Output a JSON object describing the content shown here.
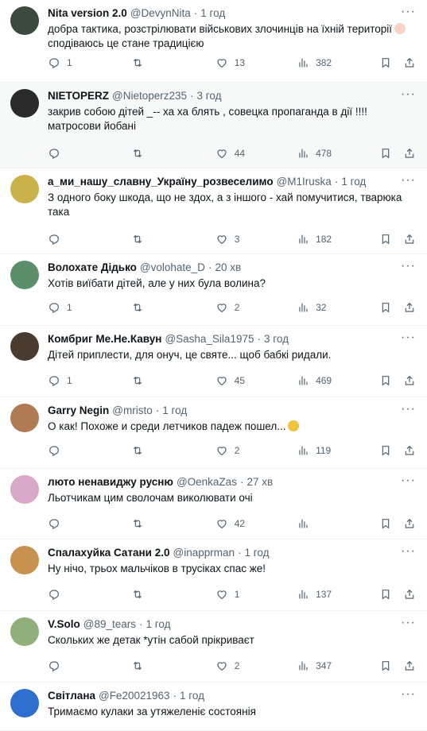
{
  "tweets": [
    {
      "name": "Nita version 2.0",
      "handle": "@DevynNita",
      "time": "1 год",
      "lines": [
        "добра тактика, розстрілювати військових злочинців на їхній території",
        "сподіваюсь це стане традицією"
      ],
      "emoji": "thumbs-up",
      "replies": "1",
      "retweets": "",
      "likes": "13",
      "views": "382",
      "highlight": false,
      "avatar_color": "#3b4a3c"
    },
    {
      "name": "NIETOPERZ",
      "handle": "@Nietoperz235",
      "time": "3 год",
      "lines": [
        "закрив собою дітей _-- ха ха блять , совецка пропаганда в дії !!!!",
        "матросови йобані"
      ],
      "replies": "",
      "retweets": "",
      "likes": "44",
      "views": "478",
      "highlight": true,
      "avatar_color": "#2a2a2a"
    },
    {
      "name": "а_ми_нашу_славну_Україну_розвеселимо",
      "handle": "@M1Iruska",
      "time": "1 год",
      "lines": [
        "З одного боку шкода, що не здох, а з іншого - хай помучитися, тварюка",
        "така"
      ],
      "replies": "",
      "retweets": "",
      "likes": "3",
      "views": "182",
      "highlight": false,
      "avatar_color": "#c9b24a"
    },
    {
      "name": "Волохате Дідько",
      "handle": "@volohate_D",
      "time": "20 хв",
      "lines": [
        "Хотів виїбати дітей, але у них була волина?"
      ],
      "replies": "1",
      "retweets": "",
      "likes": "2",
      "views": "32",
      "highlight": false,
      "avatar_color": "#5a8f6a"
    },
    {
      "name": "Комбриг Ме.Не.Кавун",
      "handle": "@Sasha_Sila1975",
      "time": "3 год",
      "lines": [
        "Дітей приплести, для онуч, це святе... щоб бабкі ридали."
      ],
      "replies": "1",
      "retweets": "",
      "likes": "45",
      "views": "469",
      "highlight": false,
      "avatar_color": "#4a3b2e"
    },
    {
      "name": "Garry Negin",
      "handle": "@mristo",
      "time": "1 год",
      "lines": [
        "О как! Похоже и среди летчиков падеж пошел..."
      ],
      "emoji": "thinking",
      "replies": "",
      "retweets": "",
      "likes": "2",
      "views": "119",
      "highlight": false,
      "avatar_color": "#b07a55"
    },
    {
      "name": "люто ненавиджу русню",
      "handle": "@OenkaZas",
      "time": "27 хв",
      "lines": [
        "Льотчикам цим сволочам виколювати очі"
      ],
      "replies": "",
      "retweets": "",
      "likes": "42",
      "views": "",
      "highlight": false,
      "avatar_color": "#d9a7c7"
    },
    {
      "name": "Спалахуйка Сатани 2.0",
      "handle": "@inapprman",
      "time": "1 год",
      "lines": [
        "Ну нічо, трьох мальчіков в трусіках спас же!"
      ],
      "replies": "",
      "retweets": "",
      "likes": "1",
      "views": "137",
      "highlight": false,
      "avatar_color": "#c8924e"
    },
    {
      "name": "V.Solo",
      "handle": "@89_tears",
      "time": "1 год",
      "lines": [
        "Скольких же детак *утін сабой прікриваєт"
      ],
      "replies": "",
      "retweets": "",
      "likes": "2",
      "views": "347",
      "highlight": false,
      "avatar_color": "#8fb07a"
    },
    {
      "name": "Світлана",
      "handle": "@Fe20021963",
      "time": "1 год",
      "lines": [
        "Тримаємо кулаки за утяжеленіє состоянія"
      ],
      "replies": "",
      "retweets": "",
      "likes": "",
      "views": "",
      "highlight": false,
      "avatar_color": "#2e6fd0"
    }
  ],
  "icons": {
    "reply": "reply-icon",
    "retweet": "retweet-icon",
    "like": "heart-icon",
    "views": "views-icon",
    "bookmark": "bookmark-icon",
    "share": "share-icon",
    "more": "more-icon"
  }
}
